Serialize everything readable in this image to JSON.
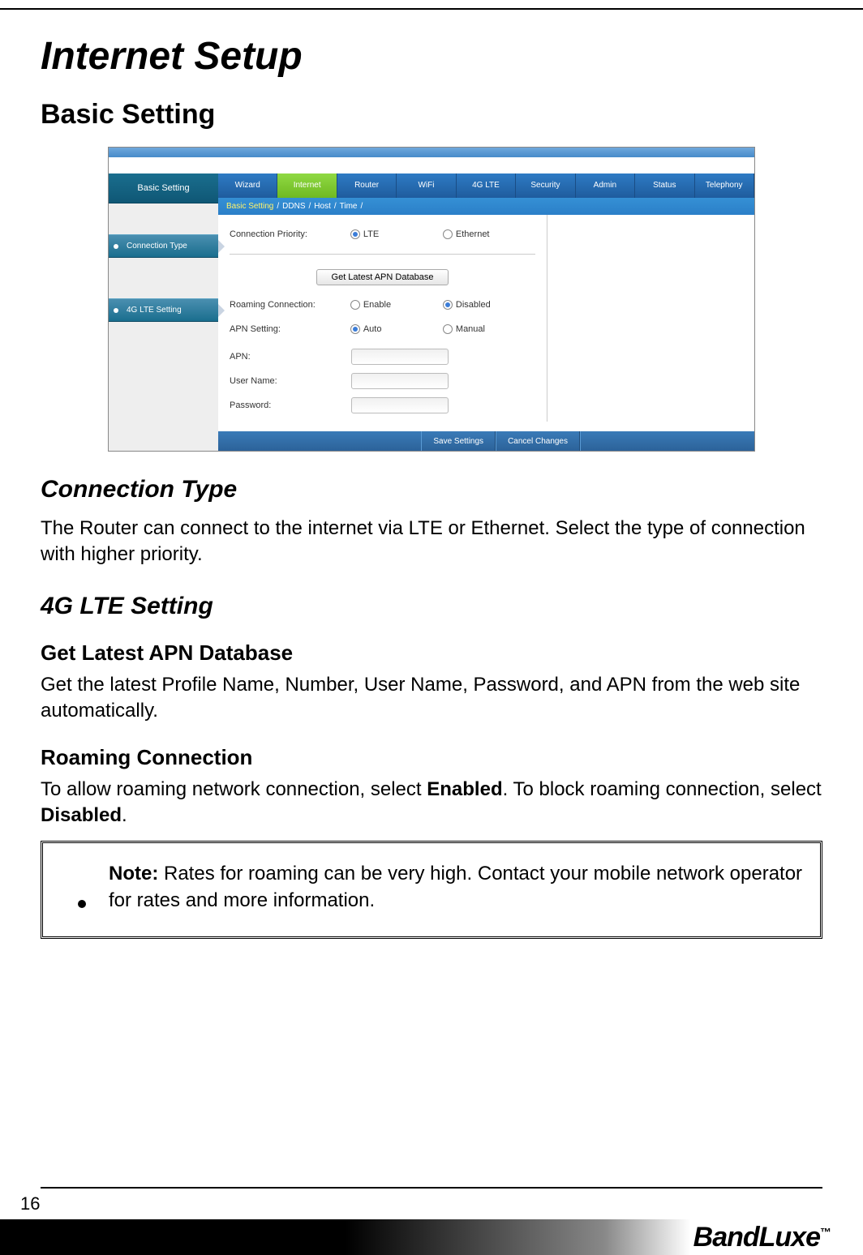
{
  "page": {
    "title": "Internet Setup",
    "section": "Basic Setting",
    "number": "16",
    "brand": "BandLuxe",
    "brand_tm": "™"
  },
  "screenshot": {
    "sidebar": {
      "title": "Basic Setting",
      "items": [
        "Connection Type",
        "4G LTE Setting"
      ]
    },
    "tabs": [
      "Wizard",
      "Internet",
      "Router",
      "WiFi",
      "4G LTE",
      "Security",
      "Admin",
      "Status",
      "Telephony"
    ],
    "active_tab_index": 1,
    "subtabs": [
      "Basic Setting",
      "DDNS",
      "Host",
      "Time"
    ],
    "active_subtab_index": 0,
    "subtab_sep": " / ",
    "form": {
      "connection_priority_label": "Connection Priority:",
      "connection_priority_options": [
        "LTE",
        "Ethernet"
      ],
      "connection_priority_selected_index": 0,
      "apn_db_button": "Get Latest APN Database",
      "roaming_label": "Roaming Connection:",
      "roaming_options": [
        "Enable",
        "Disabled"
      ],
      "roaming_selected_index": 1,
      "apn_setting_label": "APN Setting:",
      "apn_setting_options": [
        "Auto",
        "Manual"
      ],
      "apn_setting_selected_index": 0,
      "apn_label": "APN:",
      "apn_value": "",
      "username_label": "User Name:",
      "username_value": "",
      "password_label": "Password:",
      "password_value": "",
      "save_button": "Save Settings",
      "cancel_button": "Cancel Changes"
    }
  },
  "content": {
    "connection_type_title": "Connection Type",
    "connection_type_body": "The Router can connect to the internet via LTE or Ethernet. Select the type of connection with higher priority.",
    "lte_setting_title": "4G LTE Setting",
    "apn_db_title": "Get Latest APN Database",
    "apn_db_body": "Get the latest Profile Name, Number, User Name, Password, and APN from the web site automatically.",
    "roaming_title": "Roaming Connection",
    "roaming_body_pre": "To allow roaming network connection, select ",
    "roaming_body_bold1": "Enabled",
    "roaming_body_mid": ". To block roaming connection, select ",
    "roaming_body_bold2": "Disabled",
    "roaming_body_post": ".",
    "note_label": "Note:",
    "note_body": " Rates for roaming can be very high. Contact your mobile network operator for rates and more information."
  }
}
